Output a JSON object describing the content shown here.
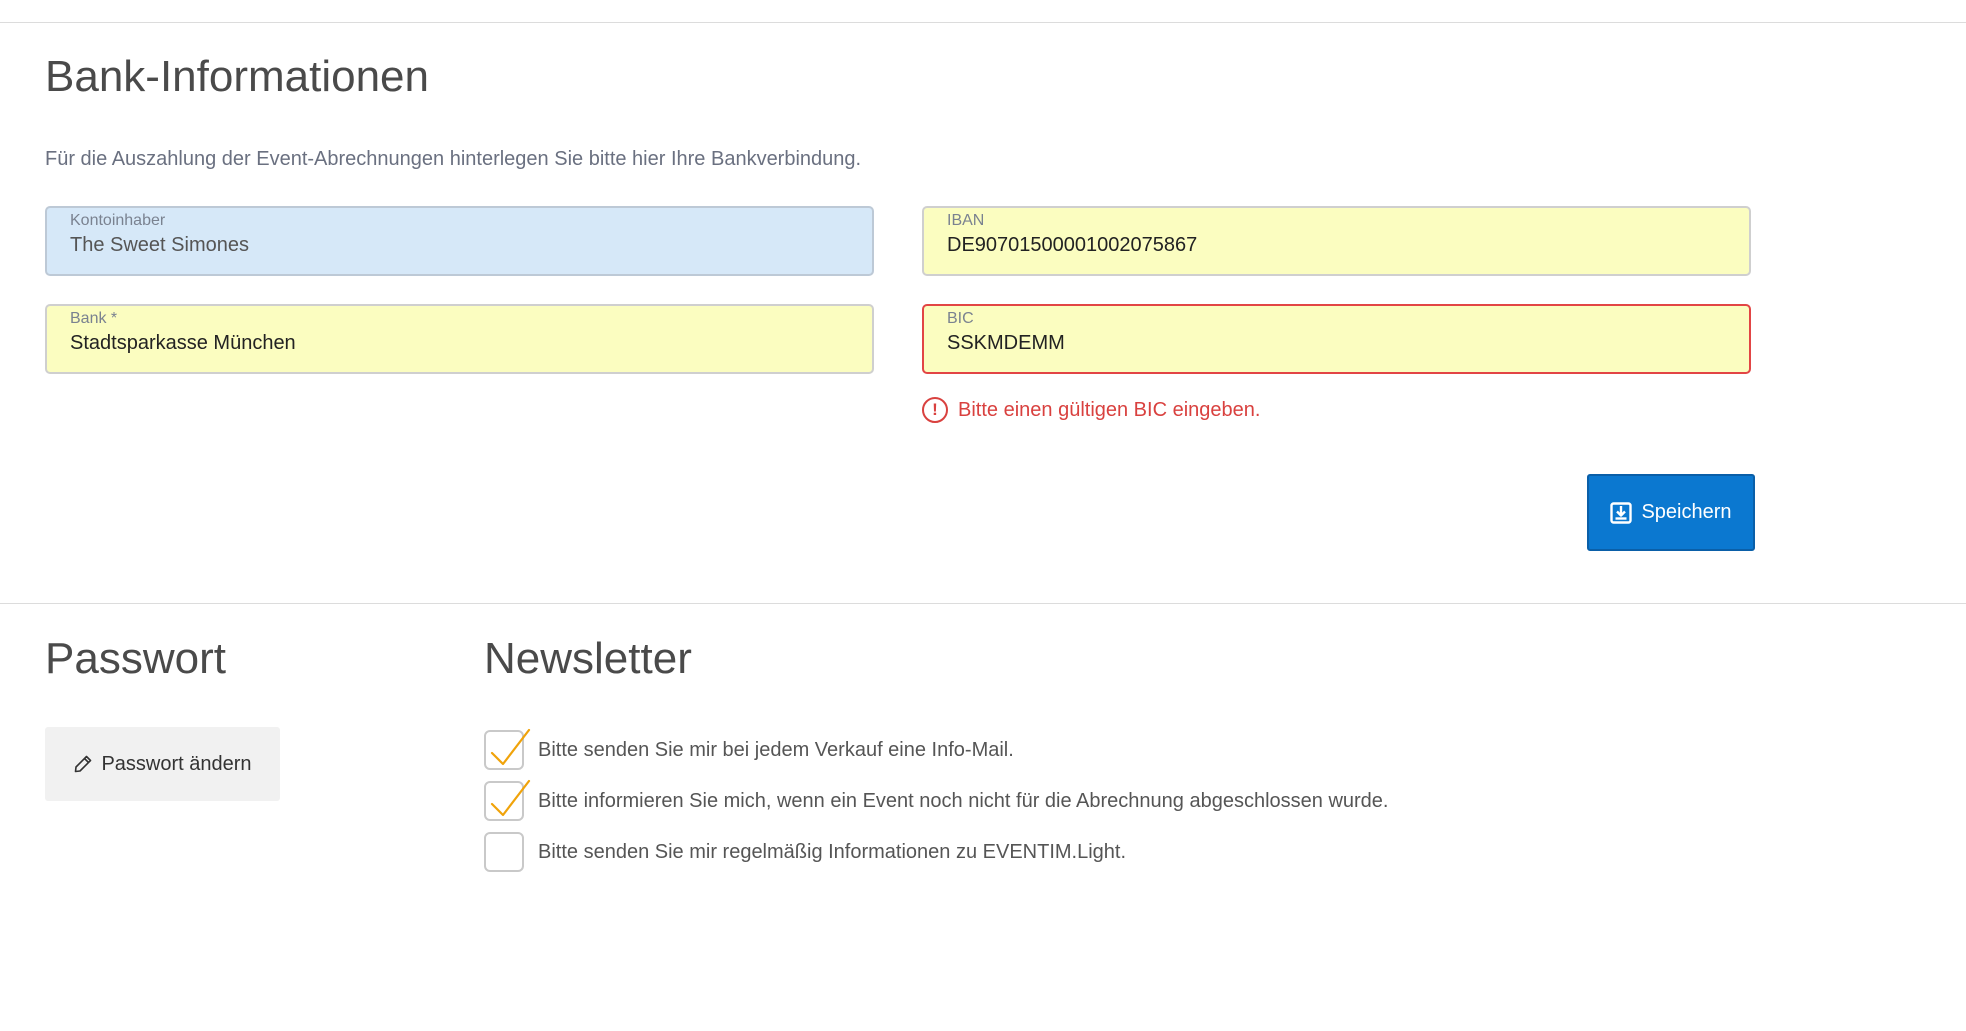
{
  "bank": {
    "title": "Bank-Informationen",
    "intro": "Für die Auszahlung der Event-Abrechnungen hinterlegen Sie bitte hier Ihre Bankverbindung.",
    "fields": {
      "kontoinhaber": {
        "label": "Kontoinhaber",
        "value": "The Sweet Simones"
      },
      "iban": {
        "label": "IBAN",
        "value": "DE90701500001002075867"
      },
      "bank": {
        "label": "Bank *",
        "value": "Stadtsparkasse München"
      },
      "bic": {
        "label": "BIC",
        "value": "SSKMDEMM"
      }
    },
    "error_icon": "!",
    "bic_error": "Bitte einen gültigen BIC eingeben.",
    "save_label": "Speichern"
  },
  "password": {
    "title": "Passwort",
    "change_label": "Passwort ändern"
  },
  "newsletter": {
    "title": "Newsletter",
    "options": [
      {
        "label": "Bitte senden Sie mir bei jedem Verkauf eine Info-Mail.",
        "checked": true
      },
      {
        "label": "Bitte informieren Sie mich, wenn ein Event noch nicht für die Abrechnung abgeschlossen wurde.",
        "checked": true
      },
      {
        "label": "Bitte senden Sie mir regelmäßig Informationen zu EVENTIM.Light.",
        "checked": false
      }
    ]
  },
  "colors": {
    "primary": "#0b78d0",
    "error": "#d9413f",
    "field_highlight": "#fbfdc0",
    "field_readonly": "#d6e8f8",
    "checkmark": "#f0a30a"
  },
  "icons": [
    "save-icon",
    "pencil-icon",
    "error-circle-icon",
    "checkmark-icon"
  ]
}
